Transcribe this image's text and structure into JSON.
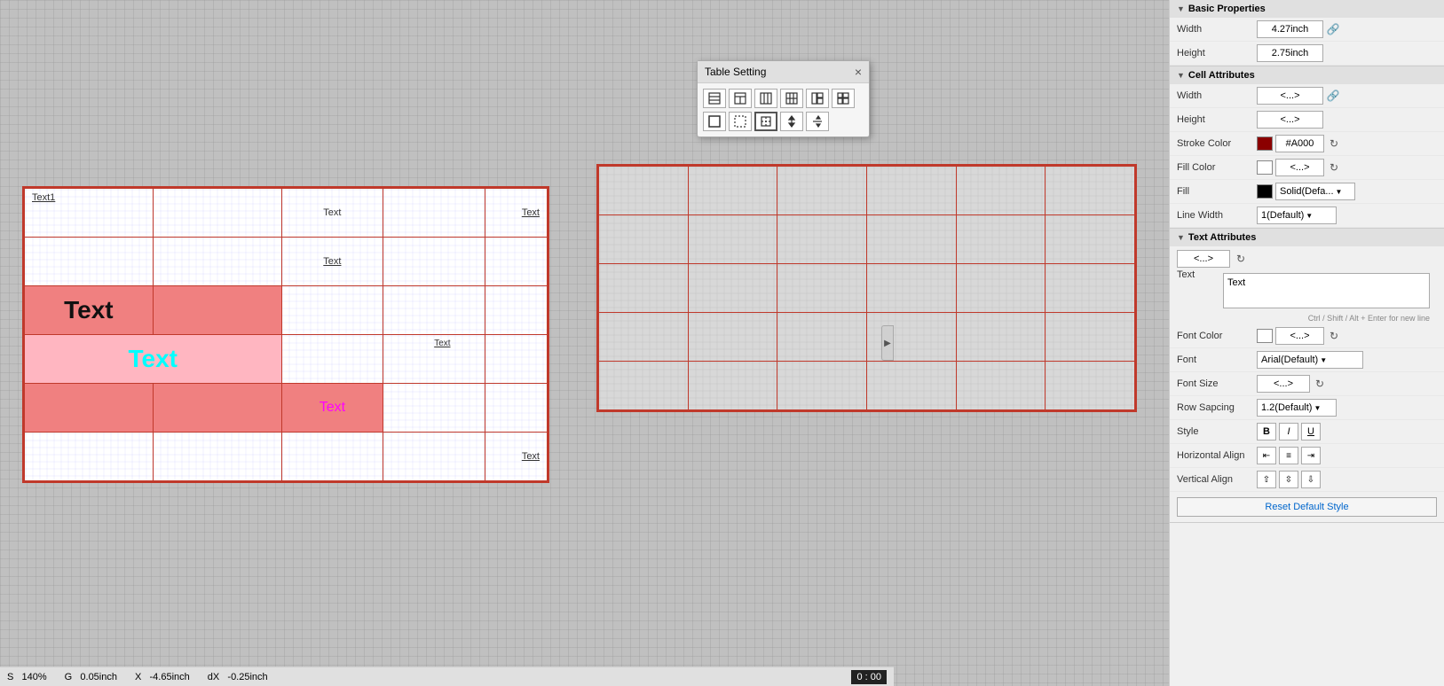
{
  "dialog": {
    "title": "Table Setting",
    "close_label": "×"
  },
  "left_table": {
    "cells": {
      "r1c1_text": "Text1",
      "r1c3_text": "Text",
      "r1c5_text": "Text",
      "r2c3_text": "Text",
      "r3c1_text": "Text",
      "r4c1_text": "Text",
      "r4c4_text": "Text",
      "r5c3_text": "Text",
      "r6c5_text": "Text"
    }
  },
  "right_panel": {
    "basic_properties": {
      "header": "Basic Properties",
      "width_label": "Width",
      "width_value": "4.27inch",
      "height_label": "Height",
      "height_value": "2.75inch"
    },
    "cell_attributes": {
      "header": "Cell Attributes",
      "width_label": "Width",
      "width_value": "<...>",
      "height_label": "Height",
      "height_value": "<...>",
      "stroke_color_label": "Stroke Color",
      "stroke_color_value": "#A000",
      "fill_color_label": "Fill Color",
      "fill_color_value": "<...>",
      "fill_label": "Fill",
      "fill_value": "Solid(Defa...",
      "line_width_label": "Line Width",
      "line_width_value": "1(Default)"
    },
    "text_attributes": {
      "header": "Text Attributes",
      "text_value": "<...>",
      "text_label": "Text",
      "text_content": "Text",
      "hint": "Ctrl / Shift / Alt + Enter for new line",
      "font_color_label": "Font Color",
      "font_color_value": "<...>",
      "font_label": "Font",
      "font_value": "Arial(Default)",
      "font_size_label": "Font Size",
      "font_size_value": "<...>",
      "row_spacing_label": "Row Sapcing",
      "row_spacing_value": "1.2(Default)",
      "style_label": "Style",
      "style_bold": "B",
      "style_italic": "I",
      "style_underline": "U",
      "h_align_label": "Horizontal Align",
      "v_align_label": "Vertical Align",
      "reset_label": "Reset Default Style"
    }
  },
  "status_bar": {
    "scale_label": "S",
    "scale_value": "140%",
    "g_label": "G",
    "g_value": "0.05inch",
    "x_label": "X",
    "x_value": "-4.65inch",
    "dx_label": "dX",
    "dx_value": "-0.25inch",
    "coords": "0 : 00"
  }
}
